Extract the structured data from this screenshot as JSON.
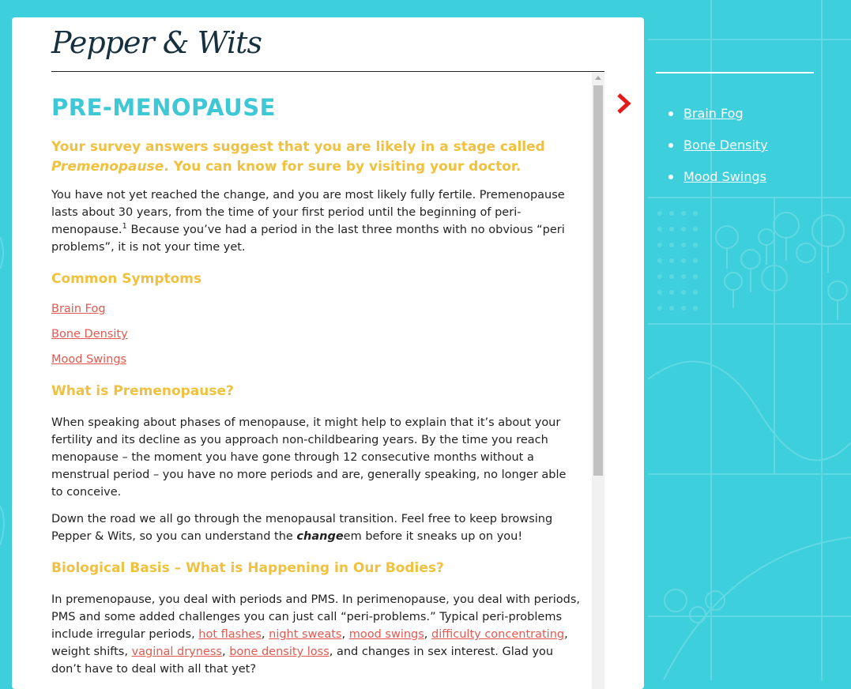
{
  "brand": {
    "logo_text": "Pepper & Wits"
  },
  "page": {
    "title": "PRE-MENOPAUSE",
    "lead_part1": "Your survey answers suggest that you are likely in a stage called ",
    "lead_em": "Premenopause",
    "lead_part2": ". You can know for sure by visiting your doctor.",
    "intro_text": "You have not yet reached the change, and you are most likely fully fertile. Premenopause lasts about 30 years, from the time of your first period until the beginning of peri-menopause.",
    "intro_footnote": "1",
    "intro_text2": " Because you’ve had a period in the last three months with no obvious “peri problems”, it is not your time yet.",
    "symptoms_heading": "Common Symptoms",
    "symptom_links": [
      "Brain Fog",
      "Bone Density",
      "Mood Swings"
    ],
    "what_heading": "What is Premenopause?",
    "what_para1": "When speaking about phases of menopause, it might help to explain that it’s about your fertility and its decline as you approach non-childbearing years. By the time you reach menopause – the moment you have gone through 12 consecutive months without a menstrual period – you have no more periods and are, generally speaking, no longer able to conceive.",
    "what_para2_a": "Down the road we all go through the menopausal transition. Feel free to keep browsing Pepper & Wits, so you can understand the ",
    "what_para2_em": "change",
    "what_para2_b": "em before it sneaks up on you!",
    "bio_heading": "Biological Basis – What is Happening in Our Bodies?",
    "bio_text_a": "In premenopause, you deal with periods and PMS. In perimenopause, you deal with periods, PMS and some added challenges you can just call “peri-problems.” Typical peri-problems include irregular periods, ",
    "bio_link1": "hot flashes",
    "bio_link2": "night sweats",
    "bio_link3": "mood swings",
    "bio_link4": "difficulty concentrating",
    "bio_text_b": "weight shifts, ",
    "bio_link5": "vaginal dryness",
    "bio_link6": "bone density loss",
    "bio_text_c": ", and changes in sex interest. Glad you don’t have to deal with all that yet?",
    "sep": ", "
  },
  "sidebar": {
    "links": [
      "Brain Fog",
      "Bone Density",
      "Mood Swings"
    ]
  },
  "colors": {
    "background": "#3ecfdc",
    "title": "#3ec7d5",
    "heading": "#efc13d",
    "link": "#e2594f",
    "chevron": "#e11b1b"
  },
  "icons": {
    "next": "chevron-right-icon",
    "scroll_up": "scroll-up-arrow-icon"
  }
}
